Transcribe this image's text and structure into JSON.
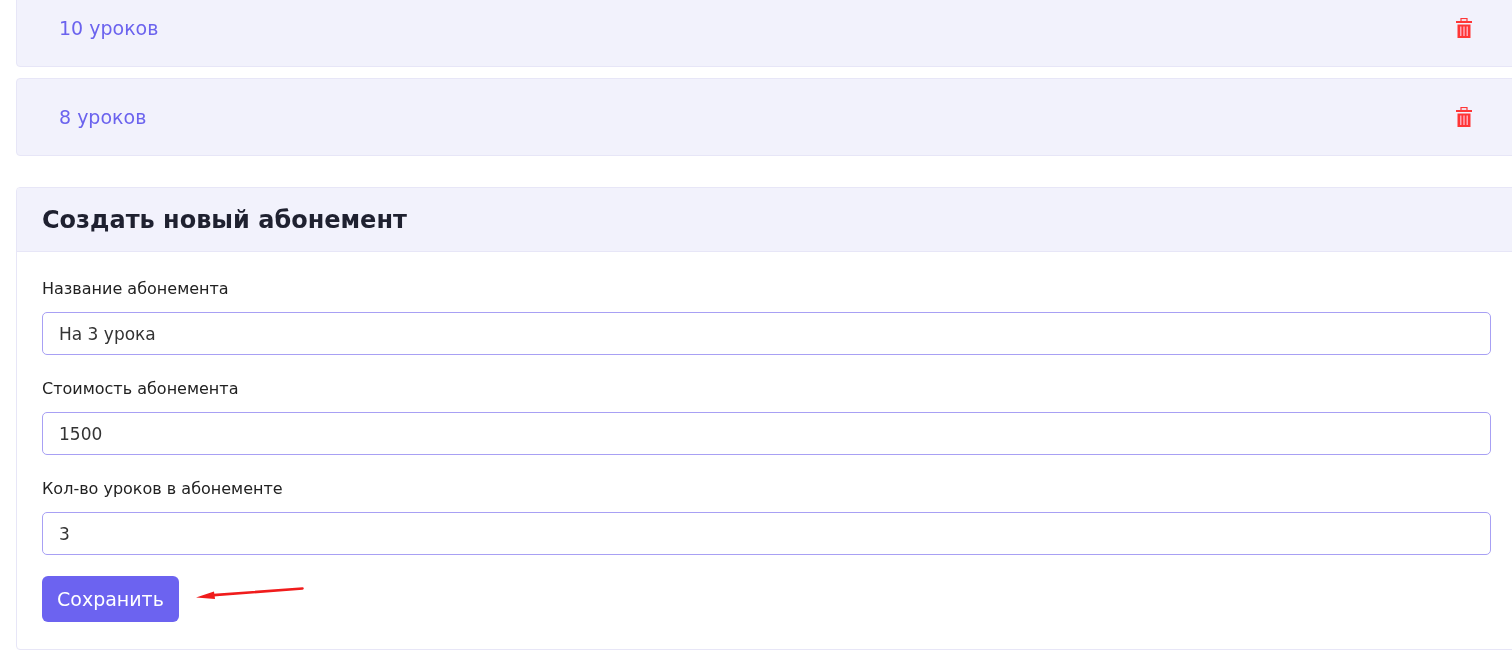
{
  "subscriptions": [
    {
      "name": "10 уроков"
    },
    {
      "name": "8 уроков"
    }
  ],
  "create_form": {
    "title": "Создать новый абонемент",
    "fields": [
      {
        "label": "Название абонемента",
        "value": "На 3 урока"
      },
      {
        "label": "Стоимость абонемента",
        "value": "1500"
      },
      {
        "label": "Кол-во уроков в абонементе",
        "value": "3"
      }
    ],
    "submit": "Сохранить"
  }
}
